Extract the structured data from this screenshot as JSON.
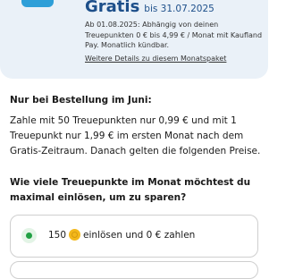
{
  "offer": {
    "gratis_label": "Gratis",
    "gratis_until": "bis 31.07.2025",
    "price_info": "Ab 01.08.2025: Abhängig von deinen Treuepunkten 0 € bis 4,99 € / Monat mit Kaufland Pay. Monatlich kündbar.",
    "details_link": "Weitere Details zu diesem Monatspaket"
  },
  "june": {
    "title": "Nur bei Bestellung im Juni:",
    "text": "Zahle mit 50 Treuepunkten nur 0,99 € und mit 1 Treuepunkt nur 1,99 € im ersten Monat nach dem Gratis-Zeitraum. Danach gelten die folgenden Preise."
  },
  "question": "Wie viele Treuepunkte im Monat möchtest du maximal einlösen, um zu sparen?",
  "options": [
    {
      "points": "150",
      "suffix": "einlösen und 0 € zahlen",
      "selected": true
    }
  ],
  "colors": {
    "brand_blue": "#1d4f8a",
    "selected_green": "#21a043",
    "card_bg": "#eaf1f8"
  },
  "icons": {
    "coin": "coin-icon"
  }
}
